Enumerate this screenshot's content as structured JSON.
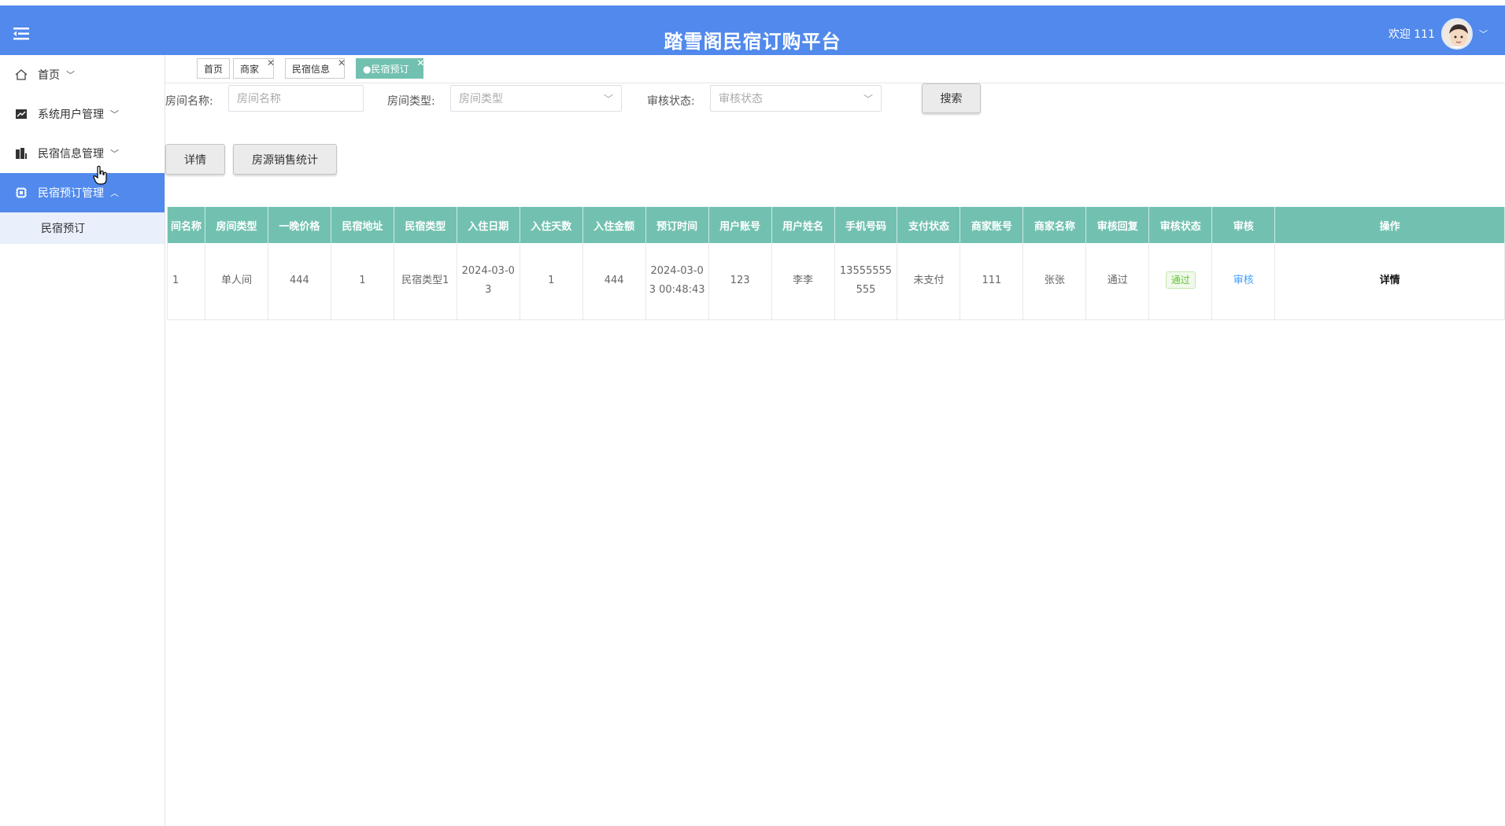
{
  "header": {
    "title": "踏雪阁民宿订购平台",
    "welcome": "欢迎 111"
  },
  "sidebar": {
    "items": [
      {
        "label": "首页",
        "icon": "home-icon"
      },
      {
        "label": "系统用户管理",
        "icon": "user-admin-icon"
      },
      {
        "label": "民宿信息管理",
        "icon": "building-icon"
      },
      {
        "label": "民宿预订管理",
        "icon": "chip-icon"
      }
    ],
    "sub": {
      "label": "民宿预订"
    }
  },
  "tabs": [
    "首页",
    "商家",
    "民宿信息",
    "●民宿预订"
  ],
  "filters": {
    "room_name_label": "房间名称:",
    "room_name_placeholder": "房间名称",
    "room_type_label": "房间类型:",
    "room_type_placeholder": "房间类型",
    "review_label": "审核状态:",
    "review_placeholder": "审核状态",
    "search": "搜索"
  },
  "actions": {
    "detail": "详情",
    "stats": "房源销售统计"
  },
  "table": {
    "headers": [
      "间名称",
      "房间类型",
      "一晚价格",
      "民宿地址",
      "民宿类型",
      "入住日期",
      "入住天数",
      "入住金额",
      "预订时间",
      "用户账号",
      "用户姓名",
      "手机号码",
      "支付状态",
      "商家账号",
      "商家名称",
      "审核回复",
      "审核状态",
      "审核",
      "操作"
    ],
    "rows": [
      [
        "1",
        "单人间",
        "444",
        "1",
        "民宿类型1",
        "2024-03-03",
        "1",
        "444",
        "2024-03-03 00:48:43",
        "123",
        "李李",
        "13555555555",
        "未支付",
        "111",
        "张张",
        "通过",
        "通过",
        "审核",
        "详情"
      ]
    ]
  },
  "colors": {
    "header": "#5189ec",
    "table_header": "#72c1b0",
    "active_tab": "#72c1b0"
  }
}
